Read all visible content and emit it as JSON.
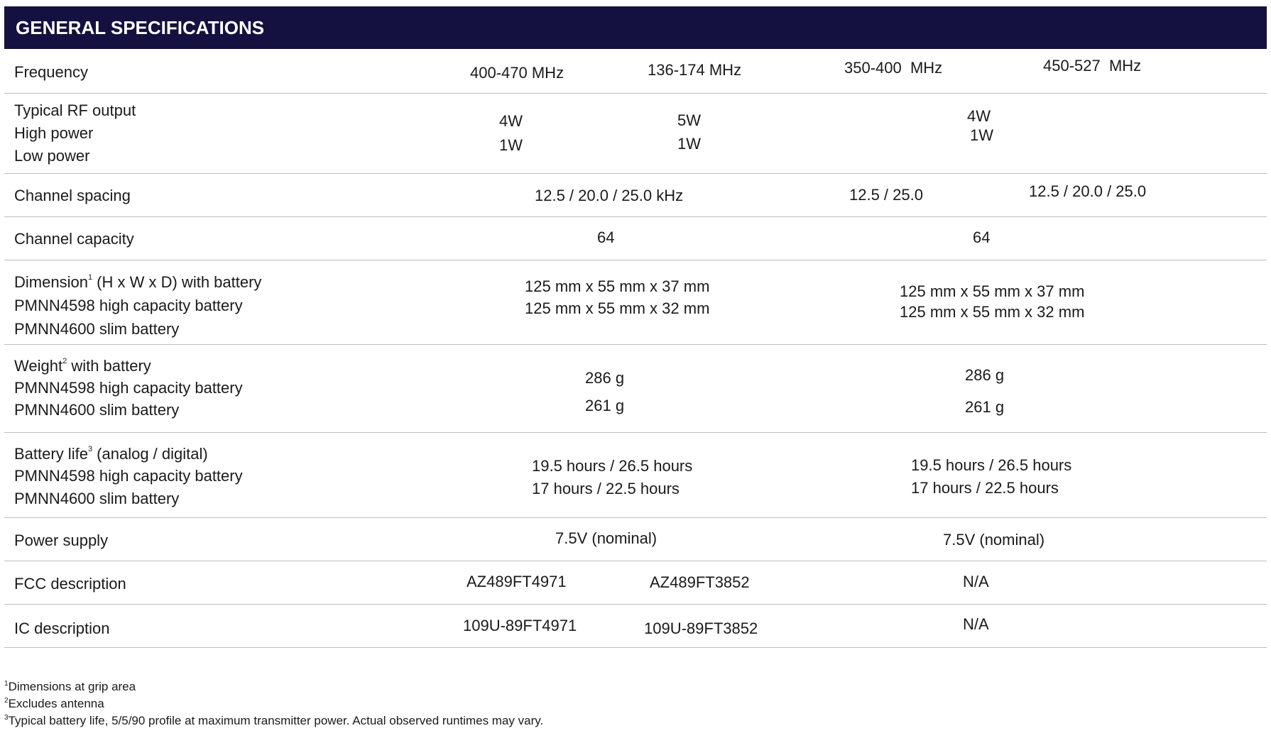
{
  "header": {
    "title": "GENERAL SPECIFICATIONS"
  },
  "rows": {
    "frequency": {
      "label": "Frequency",
      "values": [
        "400-470 MHz",
        "136-174 MHz",
        "350-400  MHz",
        "450-527  MHz"
      ]
    },
    "rf_output": {
      "label": "Typical RF output",
      "sub1": "High power",
      "sub2": "Low power",
      "c1_high": "4W",
      "c1_low": "1W",
      "c2_high": "5W",
      "c2_low": "1W",
      "c3_high": "4W",
      "c3_low": "1W"
    },
    "channel_spacing": {
      "label": "Channel spacing",
      "values": [
        "12.5 / 20.0 / 25.0 kHz",
        "12.5 / 25.0",
        "12.5 / 20.0 / 25.0"
      ]
    },
    "channel_capacity": {
      "label": "Channel capacity",
      "values": [
        "64",
        "64"
      ]
    },
    "dimension": {
      "label_pre": "Dimension",
      "label_sup": "1",
      "label_post": " (H x W x D) with battery",
      "sub1": "PMNN4598 high capacity battery",
      "sub2": "PMNN4600 slim battery",
      "left1": "125 mm x 55 mm x 37 mm",
      "left2": "125 mm x 55 mm x 32 mm",
      "right1": "125 mm x 55 mm x 37 mm",
      "right2": "125 mm x 55 mm x 32 mm"
    },
    "weight": {
      "label_pre": "Weight",
      "label_sup": "2",
      "label_post": " with battery",
      "sub1": "PMNN4598 high capacity battery",
      "sub2": "PMNN4600 slim battery",
      "left1": "286 g",
      "left2": "261 g",
      "right1": "286 g",
      "right2": "261 g"
    },
    "battery_life": {
      "label_pre": "Battery life",
      "label_sup": "3",
      "label_post": " (analog / digital)",
      "sub1": "PMNN4598 high capacity battery",
      "sub2": "PMNN4600 slim battery",
      "left1": "19.5 hours / 26.5 hours",
      "left2": "17 hours / 22.5 hours",
      "right1": "19.5 hours / 26.5 hours",
      "right2": "17 hours / 22.5 hours"
    },
    "power_supply": {
      "label": "Power supply",
      "values": [
        "7.5V (nominal)",
        "7.5V (nominal)"
      ]
    },
    "fcc": {
      "label": "FCC description",
      "values": [
        "AZ489FT4971",
        "AZ489FT3852",
        "N/A"
      ]
    },
    "ic": {
      "label": "IC description",
      "values": [
        "109U-89FT4971",
        "109U-89FT3852",
        "N/A"
      ]
    }
  },
  "footnotes": [
    {
      "num": "1",
      "text": "Dimensions at grip area"
    },
    {
      "num": "2",
      "text": "Excludes antenna"
    },
    {
      "num": "3",
      "text": "Typical battery life, 5/5/90 profile at maximum transmitter power. Actual observed runtimes may vary."
    }
  ]
}
